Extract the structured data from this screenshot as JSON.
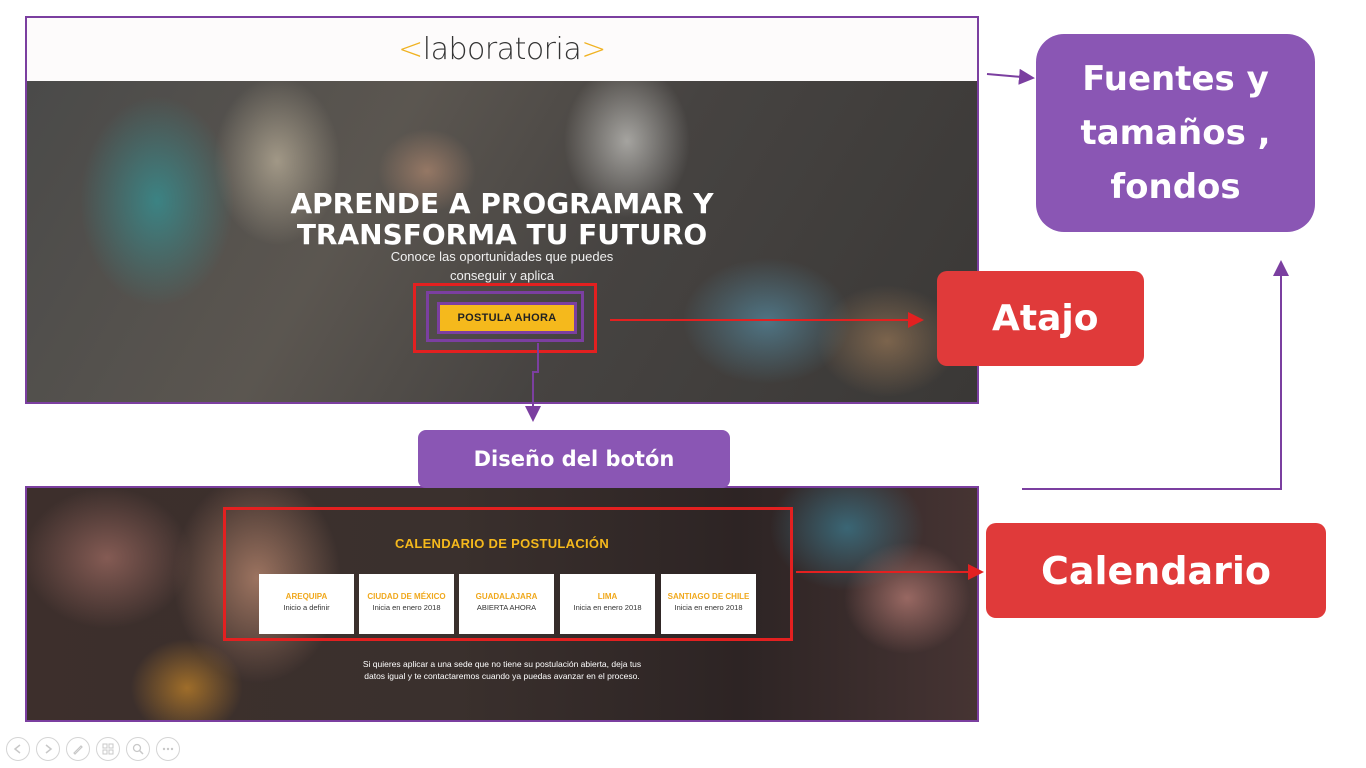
{
  "top_panel": {
    "logo": {
      "open": "<",
      "text": "laboratoria",
      "close": ">"
    },
    "hero_title": "APRENDE A PROGRAMAR  Y\nTRANSFORMA TU FUTURO",
    "hero_subtitle": "Conoce las oportunidades que puedes\nconseguir y aplica",
    "cta_label": "POSTULA AHORA"
  },
  "bottom_panel": {
    "title": "CALENDARIO DE POSTULACIÓN",
    "cards": [
      {
        "city": "AREQUIPA",
        "status": "Inicio a definir"
      },
      {
        "city": "CIUDAD DE MÉXICO",
        "status": "Inicia en enero 2018"
      },
      {
        "city": "GUADALAJARA",
        "status": "ABIERTA AHORA"
      },
      {
        "city": "LIMA",
        "status": "Inicia en enero 2018"
      },
      {
        "city": "SANTIAGO DE CHILE",
        "status": "Inicia en enero 2018"
      }
    ],
    "note": "Si quieres aplicar a una sede que no tiene su postulación abierta, deja tus\ndatos igual y te contactaremos cuando  ya puedas avanzar en el proceso."
  },
  "callouts": {
    "fuentes": "Fuentes y\ntamaños ,\nfondos",
    "atajo": "Atajo",
    "boton": "Diseño del botón",
    "calendario": "Calendario"
  },
  "colors": {
    "brand_yellow": "#f5b91c",
    "purple": "#8a56b4",
    "red": "#e03a3a",
    "frame_purple": "#7b3fa0",
    "frame_red": "#e32020"
  },
  "toolbar": {
    "icons": [
      "previous-icon",
      "next-icon",
      "pen-icon",
      "slides-icon",
      "zoom-icon",
      "more-icon"
    ]
  }
}
